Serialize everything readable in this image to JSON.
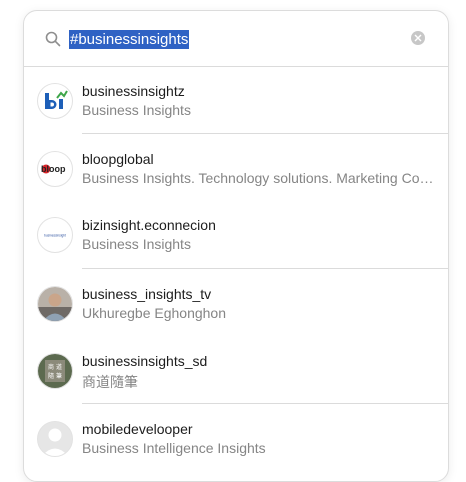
{
  "search": {
    "query": "#businessinsights"
  },
  "results": [
    {
      "username": "businessinsightz",
      "fullname": "Business Insights",
      "avatar": "bi-logo-icon"
    },
    {
      "username": "bloopglobal",
      "fullname": "Business Insights. Technology solutions. Marketing Consulting",
      "avatar": "bloop-logo-icon"
    },
    {
      "username": "bizinsight.econnecion",
      "fullname": "Business Insights",
      "avatar": "bizinsight-logo-icon"
    },
    {
      "username": "business_insights_tv",
      "fullname": "Ukhuregbe Eghonghon",
      "avatar": "person-photo-icon"
    },
    {
      "username": "businessinsights_sd",
      "fullname": "商道隨筆",
      "avatar": "calligraphy-photo-icon"
    },
    {
      "username": "mobiledevelooper",
      "fullname": "Business Intelligence Insights",
      "avatar": "default-user-icon"
    }
  ],
  "avatar_texts": {
    "bloop": "bloop",
    "bizinsight": "businessinsight",
    "calligraphy": [
      "商 道",
      "隨 筆"
    ]
  },
  "colors": {
    "selection": "#2f62c4",
    "bi_blue": "#1d5fb8",
    "bi_green": "#3fa64a",
    "bloop_red": "#d8242a"
  }
}
